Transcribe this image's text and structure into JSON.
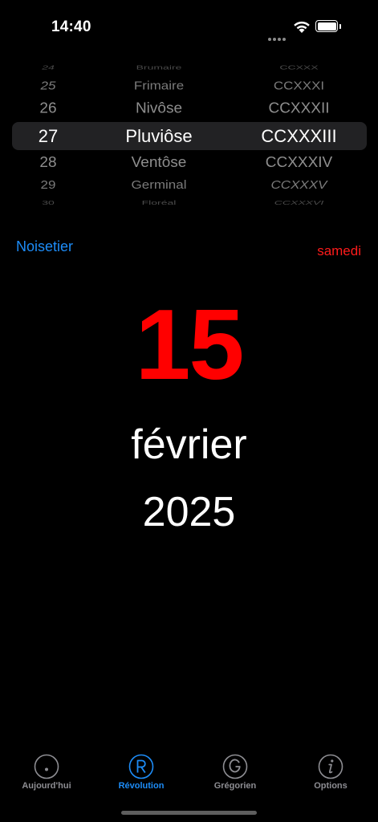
{
  "status_bar": {
    "time": "14:40"
  },
  "picker": {
    "rows": [
      {
        "day": "24",
        "month": "Brumaire",
        "year": "CCXXX"
      },
      {
        "day": "25",
        "month": "Frimaire",
        "year": "CCXXXI"
      },
      {
        "day": "26",
        "month": "Nivôse",
        "year": "CCXXXII"
      },
      {
        "day": "27",
        "month": "Pluviôse",
        "year": "CCXXXIII"
      },
      {
        "day": "28",
        "month": "Ventôse",
        "year": "CCXXXIV"
      },
      {
        "day": "29",
        "month": "Germinal",
        "year": "CCXXXV"
      },
      {
        "day": "30",
        "month": "Floréal",
        "year": "CCXXXVI"
      }
    ],
    "selected_index": 3
  },
  "day_name": "Noisetier",
  "weekday": "samedi",
  "date": {
    "day": "15",
    "month": "février",
    "year": "2025"
  },
  "tabs": [
    {
      "label": "Aujourd'hui",
      "icon": "dot-circle-icon",
      "active": false
    },
    {
      "label": "Révolution",
      "icon": "r-circle-icon",
      "active": true
    },
    {
      "label": "Grégorien",
      "icon": "g-circle-icon",
      "active": false
    },
    {
      "label": "Options",
      "icon": "info-circle-icon",
      "active": false
    }
  ],
  "colors": {
    "background": "#000000",
    "accent": "#1d8cf7",
    "highlight_red": "#ff0000",
    "inactive_tab": "#8d8d92"
  }
}
